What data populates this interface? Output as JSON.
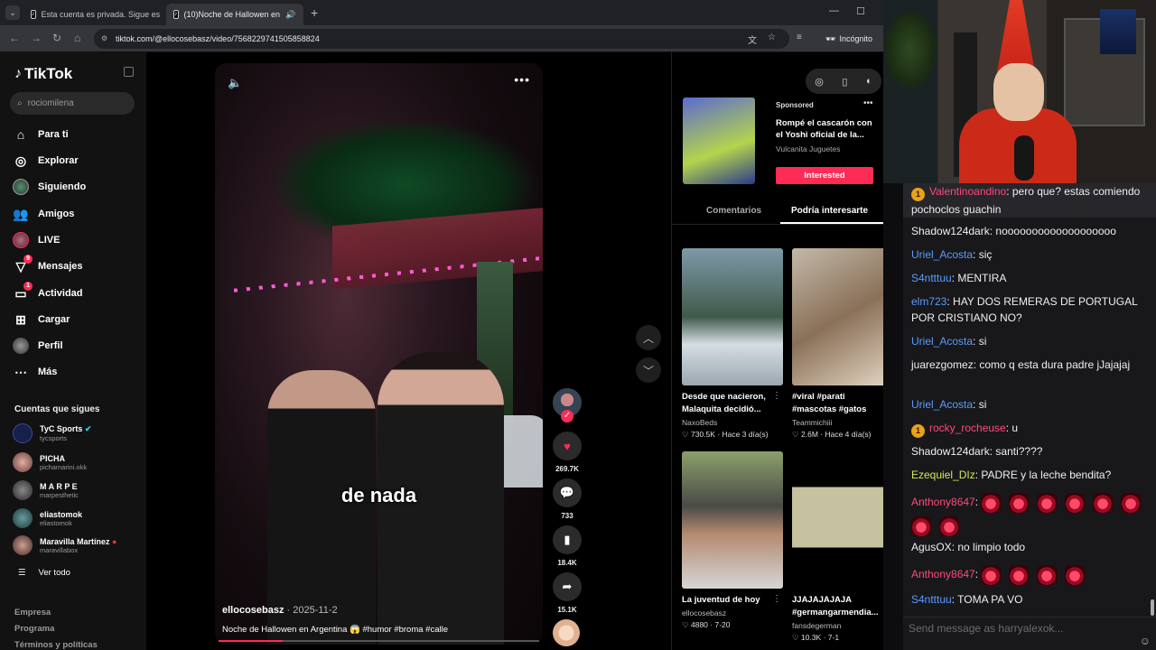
{
  "browser": {
    "tabs": [
      {
        "title": "Esta cuenta es privada. Sigue es",
        "active": false
      },
      {
        "title": "(10)Noche de Hallowen en",
        "active": true
      }
    ],
    "new_tab": "+",
    "url": "tiktok.com/@ellocosebasz/video/7568229741505858824",
    "incognito_label": "Incógnito",
    "minimize": "—",
    "maximize": "☐"
  },
  "sidebar": {
    "logo": "TikTok",
    "search_placeholder": "rociomilena",
    "nav": [
      {
        "label": "Para ti",
        "icon": "home-icon"
      },
      {
        "label": "Explorar",
        "icon": "compass-icon"
      },
      {
        "label": "Siguiendo",
        "icon": "following-avatar-icon"
      },
      {
        "label": "Amigos",
        "icon": "friends-icon"
      },
      {
        "label": "LIVE",
        "icon": "live-icon"
      },
      {
        "label": "Mensajes",
        "icon": "messages-icon",
        "badge": "9"
      },
      {
        "label": "Actividad",
        "icon": "activity-icon",
        "badge": "1"
      },
      {
        "label": "Cargar",
        "icon": "upload-icon"
      },
      {
        "label": "Perfil",
        "icon": "profile-icon"
      },
      {
        "label": "Más",
        "icon": "more-icon"
      }
    ],
    "following_title": "Cuentas que sigues",
    "accounts": [
      {
        "name": "TyC Sports",
        "handle": "tycsports",
        "verified": true
      },
      {
        "name": "PICHA",
        "handle": "pichamarini.okk"
      },
      {
        "name": "M A R P E",
        "handle": "marpesthetic"
      },
      {
        "name": "eliastomok",
        "handle": "eliastomok"
      },
      {
        "name": "Maravilla Martínez",
        "handle": "maravillabox"
      }
    ],
    "see_all": "Ver todo",
    "footer": [
      "Empresa",
      "Programa",
      "Términos y políticas"
    ]
  },
  "video": {
    "caption_word": "de nada",
    "author": "ellocosebasz",
    "date": "2025-11-2",
    "description": "Noche de Hallowen en Argentina 😱 #humor #broma #calle",
    "progress": 0.2,
    "likes": "269.7K",
    "comments": "733",
    "saves": "18.4K",
    "shares": "15.1K"
  },
  "right_panel": {
    "ad": {
      "sponsored": "Sponsored",
      "title": "Rompé el cascarón con el Yoshi oficial de la...",
      "brand": "Vulcanita Juguetes",
      "cta": "Interested"
    },
    "tabs": [
      "Comentarios",
      "Podría interesarte"
    ],
    "cards": [
      {
        "title": "Desde que nacieron, Malaquita decidió...",
        "author": "NaxoBeds",
        "likes": "730.5K",
        "date": "Hace 3 día(s)"
      },
      {
        "title": "#viral #parati #mascotas #gatos",
        "author": "Teammichiii",
        "likes": "2.6M",
        "date": "Hace 4 día(s)"
      },
      {
        "title": "La juventud de hoy",
        "author": "ellocosebasz",
        "likes": "4880",
        "date": "7-20"
      },
      {
        "title": "JJAJAJAJAJA #germangarmendia...",
        "author": "fansdegerman",
        "likes": "10.3K",
        "date": "7-1"
      }
    ]
  },
  "chat": {
    "messages": [
      {
        "user": "Valentinoandino",
        "color": "#ff4a7a",
        "text": "pero que? estas comiendo pochoclos guachin",
        "badge": "1",
        "highlight": true
      },
      {
        "user": "Shadow124dark",
        "color": "#efeff1",
        "text": "nooooooooooooooooooo"
      },
      {
        "user": "Uriel_Acosta",
        "color": "#5a9cff",
        "text": "siç"
      },
      {
        "user": "S4ntttuu",
        "color": "#5a9cff",
        "text": "MENTIRA"
      },
      {
        "user": "elm723",
        "color": "#5a9cff",
        "text": "HAY DOS REMERAS DE PORTUGAL POR CRISTIANO NO?"
      },
      {
        "user": "Uriel_Acosta",
        "color": "#5a9cff",
        "text": "si"
      },
      {
        "user": "juarezgomez",
        "color": "#efeff1",
        "text": "como q esta dura padre jJajajaj"
      },
      {
        "user": "Uriel_Acosta",
        "color": "#5a9cff",
        "text": "si"
      },
      {
        "user": "rocky_rocheuse",
        "color": "#ff4a7a",
        "text": "u",
        "badge": "1"
      },
      {
        "user": "Shadow124dark",
        "color": "#efeff1",
        "text": "santi????"
      },
      {
        "user": "Ezequiel_DIz",
        "color": "#d4e85a",
        "text": "PADRE y la leche bendita?"
      },
      {
        "user": "Anthony8647",
        "color": "#ff4a7a",
        "text": "",
        "emotes": 8
      },
      {
        "user": "AgusOX",
        "color": "#efeff1",
        "text": "no limpio todo"
      },
      {
        "user": "Anthony8647",
        "color": "#ff4a7a",
        "text": "",
        "emotes": 4
      },
      {
        "user": "S4ntttuu",
        "color": "#5a9cff",
        "text": "TOMA PA VO"
      }
    ],
    "input_placeholder": "Send message as harryalexok..."
  },
  "colors": {
    "accent": "#fe2c55",
    "chat_bg": "#18181b"
  }
}
